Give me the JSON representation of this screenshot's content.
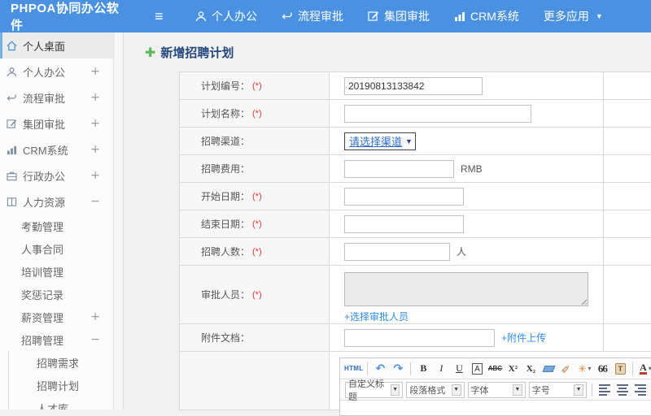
{
  "topbar": {
    "logo": "PHPOA协同办公软件",
    "nav": [
      {
        "label": "个人办公"
      },
      {
        "label": "流程审批"
      },
      {
        "label": "集团审批"
      },
      {
        "label": "CRM系统"
      },
      {
        "label": "更多应用"
      }
    ]
  },
  "sidebar": {
    "items": [
      {
        "label": "个人桌面"
      },
      {
        "label": "个人办公",
        "expand": "+"
      },
      {
        "label": "流程审批",
        "expand": "+"
      },
      {
        "label": "集团审批",
        "expand": "+"
      },
      {
        "label": "CRM系统",
        "expand": "+"
      },
      {
        "label": "行政办公",
        "expand": "+"
      },
      {
        "label": "人力资源",
        "expand": "−"
      },
      {
        "label": "考勤管理"
      },
      {
        "label": "人事合同"
      },
      {
        "label": "培训管理"
      },
      {
        "label": "奖惩记录"
      },
      {
        "label": "薪资管理",
        "expand": "+"
      },
      {
        "label": "招聘管理",
        "expand": "−"
      },
      {
        "label": "招聘需求"
      },
      {
        "label": "招聘计划"
      },
      {
        "label": "人才库"
      }
    ]
  },
  "main": {
    "title": "新增招聘计划",
    "form": {
      "plan_no": {
        "label": "计划编号：",
        "required": "(*)",
        "value": "20190813133842"
      },
      "plan_name": {
        "label": "计划名称：",
        "required": "(*)"
      },
      "channel": {
        "label": "招聘渠道：",
        "value": "请选择渠道"
      },
      "cost": {
        "label": "招聘费用：",
        "suffix": "RMB"
      },
      "start": {
        "label": "开始日期：",
        "required": "(*)"
      },
      "end": {
        "label": "结束日期：",
        "required": "(*)"
      },
      "headcount": {
        "label": "招聘人数：",
        "required": "(*)",
        "suffix": "人"
      },
      "approver": {
        "label": "审批人员：",
        "required": "(*)",
        "link": "+选择审批人员"
      },
      "attachment": {
        "label": "附件文档：",
        "link": "+附件上传"
      }
    },
    "editor": {
      "html": "HTML",
      "bold": "B",
      "italic": "I",
      "underline": "U",
      "autotypeset": "A",
      "strikethrough": "ABC",
      "superscript": "X²",
      "subscript": "X₂",
      "quote": "66",
      "paste": "T",
      "fontcolor": "A",
      "highlight": "ab",
      "dropdowns": {
        "style": "自定义标题",
        "paragraph": "段落格式",
        "font": "字体",
        "size": "字号"
      }
    }
  },
  "colors": {
    "topbar": "#4a91e2",
    "link": "#2d8cf0",
    "title": "#25477b",
    "required": "#e53333"
  }
}
